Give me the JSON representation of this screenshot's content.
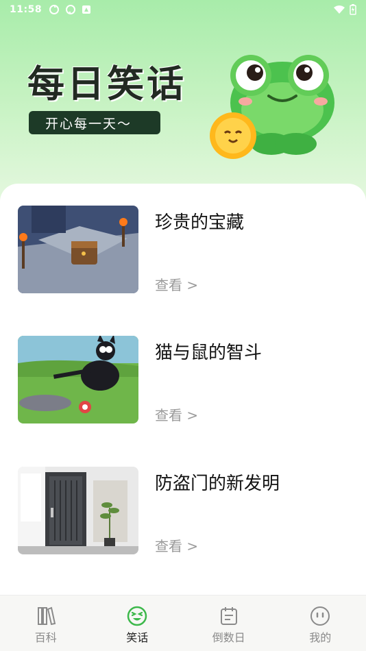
{
  "status_bar": {
    "time": "11:58"
  },
  "hero": {
    "title": "每日笑话",
    "subtitle": "开心每一天～"
  },
  "jokes": [
    {
      "title": "珍贵的宝藏",
      "view_label": "查看 >"
    },
    {
      "title": "猫与鼠的智斗",
      "view_label": "查看 >"
    },
    {
      "title": "防盗门的新发明",
      "view_label": "查看 >"
    }
  ],
  "tabs": [
    {
      "label": "百科",
      "icon": "books-icon",
      "active": false
    },
    {
      "label": "笑话",
      "icon": "laughing-face-icon",
      "active": true
    },
    {
      "label": "倒数日",
      "icon": "calendar-icon",
      "active": false
    },
    {
      "label": "我的",
      "icon": "neutral-face-icon",
      "active": false
    }
  ],
  "colors": {
    "accent": "#3cb84a",
    "hero_top": "#a8ecaa",
    "pill_bg": "#1d3a27",
    "muted_text": "#9a9a9a"
  }
}
